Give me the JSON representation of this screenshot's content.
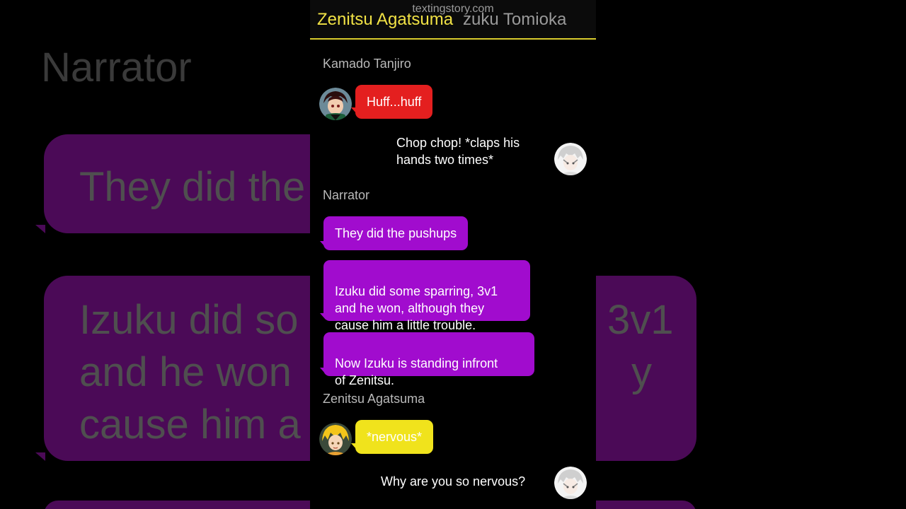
{
  "header": {
    "watermark": "textingstory.com",
    "title_primary": "Zenitsu Agatsuma",
    "title_secondary": "zuku Tomioka"
  },
  "background": {
    "narrator_label": "Narrator",
    "bubble1_text": "They did the",
    "bubble2_lines": [
      "Izuku did so",
      "and he won",
      "cause him a"
    ],
    "bubble2_right_lines": [
      "3v1",
      "y"
    ]
  },
  "messages": [
    {
      "sender": "Kamado Tanjiro",
      "text": "Huff...huff",
      "side": "left",
      "bubble_color": "#e41f1f",
      "avatar_icon": "tanjiro-avatar-icon"
    },
    {
      "text_lines": [
        "Chop chop! *claps his",
        "hands two times*"
      ],
      "side": "right",
      "avatar_icon": "izuku-avatar-icon"
    },
    {
      "sender": "Narrator",
      "texts": [
        "They did the pushups",
        "Izuku did some sparring, 3v1\nand he won, although they\ncause him a little trouble.",
        "Now Izuku is standing infront\nof Zenitsu."
      ],
      "side": "left",
      "bubble_color": "#a10cce"
    },
    {
      "sender": "Zenitsu Agatsuma",
      "text": "*nervous*",
      "side": "left",
      "bubble_color": "#f0e31c",
      "avatar_icon": "zenitsu-avatar-icon"
    },
    {
      "text": "Why are you so nervous?",
      "side": "right",
      "avatar_icon": "izuku-avatar-icon"
    }
  ],
  "colors": {
    "header_accent": "#d9cc2e",
    "narrator_purple": "#a10cce",
    "tanjiro_red": "#e41f1f",
    "zenitsu_yellow": "#f0e31c"
  }
}
